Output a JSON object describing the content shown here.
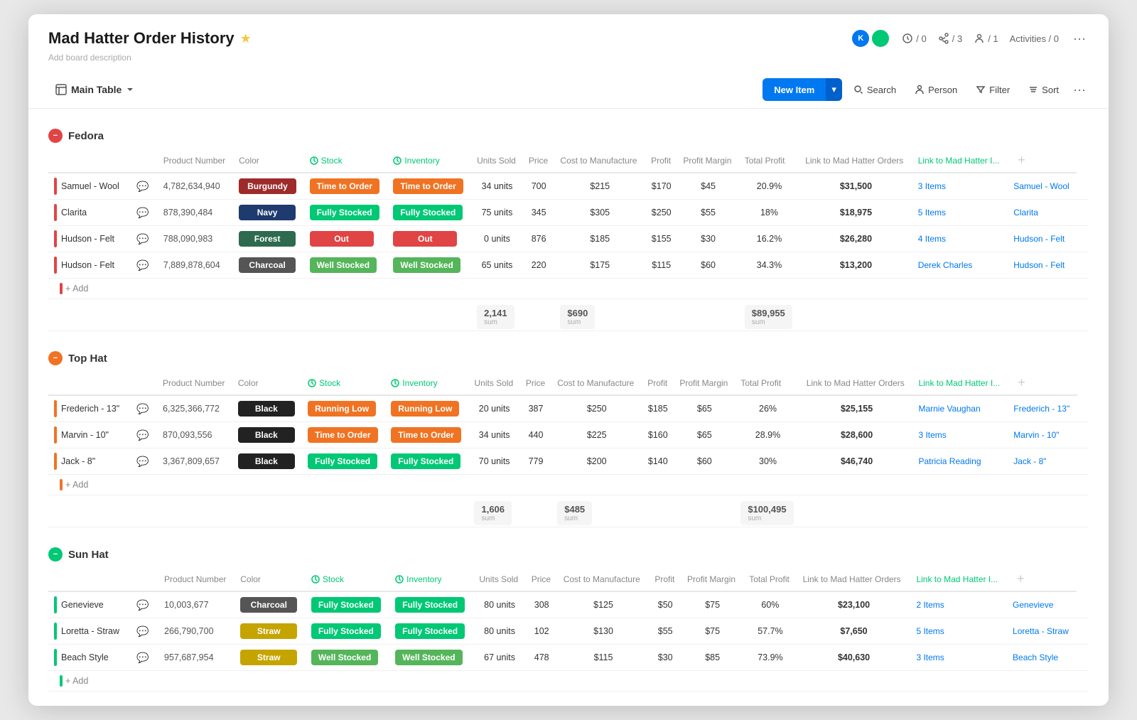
{
  "app": {
    "title": "Mad Hatter Order History",
    "description": "Add board description",
    "star": "★"
  },
  "header": {
    "avatars": [
      {
        "initials": "K",
        "color": "blue"
      },
      {
        "initials": "",
        "color": "green"
      }
    ],
    "stats": [
      {
        "icon": "search-updates",
        "value": "/ 0"
      },
      {
        "icon": "share",
        "value": "/ 3"
      },
      {
        "icon": "people",
        "value": "/ 1"
      },
      {
        "label": "Activities / 0"
      }
    ],
    "more": "···"
  },
  "toolbar": {
    "main_table_label": "Main Table",
    "new_item_label": "New Item",
    "search_label": "Search",
    "person_label": "Person",
    "filter_label": "Filter",
    "sort_label": "Sort",
    "more": "···"
  },
  "groups": [
    {
      "id": "fedora",
      "name": "Fedora",
      "color": "fedora",
      "columns": [
        "Product Number",
        "Color",
        "Stock",
        "Inventory",
        "Units Sold",
        "Price",
        "Cost to Manufacture",
        "Profit",
        "Profit Margin",
        "Total Profit",
        "Link to Mad Hatter Orders",
        "Link to Mad Hatter I..."
      ],
      "rows": [
        {
          "name": "Samuel - Wool",
          "product_number": "4,782,634,940",
          "color": "Burgundy",
          "color_chip": "chip-burgundy",
          "stock": "Time to Order",
          "stock_chip": "chip-tto",
          "inventory": "Time to Order",
          "inventory_chip": "chip-tto",
          "units_sold": "34 units",
          "price": "700",
          "ctm": "$215",
          "profit": "$170",
          "p_margin": "$45",
          "p_margin_pct": "20.9%",
          "total_profit": "$31,500",
          "link_orders": "3 Items",
          "link_other": "Samuel - Wool"
        },
        {
          "name": "Clarita",
          "product_number": "878,390,484",
          "color": "Navy",
          "color_chip": "chip-navy",
          "stock": "Fully Stocked",
          "stock_chip": "chip-fs",
          "inventory": "Fully Stocked",
          "inventory_chip": "chip-fs",
          "units_sold": "75 units",
          "price": "345",
          "ctm": "$305",
          "profit": "$250",
          "p_margin": "$55",
          "p_margin_pct": "18%",
          "total_profit": "$18,975",
          "link_orders": "5 Items",
          "link_other": "Clarita"
        },
        {
          "name": "Hudson - Felt",
          "product_number": "788,090,983",
          "color": "Forest",
          "color_chip": "chip-forest",
          "stock": "Out",
          "stock_chip": "chip-out",
          "inventory": "Out",
          "inventory_chip": "chip-out",
          "units_sold": "0 units",
          "price": "876",
          "ctm": "$185",
          "profit": "$155",
          "p_margin": "$30",
          "p_margin_pct": "16.2%",
          "total_profit": "$26,280",
          "link_orders": "4 Items",
          "link_other": "Hudson - Felt"
        },
        {
          "name": "Hudson - Felt",
          "product_number": "7,889,878,604",
          "color": "Charcoal",
          "color_chip": "chip-charcoal",
          "stock": "Well Stocked",
          "stock_chip": "chip-ws",
          "inventory": "Well Stocked",
          "inventory_chip": "chip-ws",
          "units_sold": "65 units",
          "price": "220",
          "ctm": "$175",
          "profit": "$115",
          "p_margin": "$60",
          "p_margin_pct": "34.3%",
          "total_profit": "$13,200",
          "link_orders": "Derek Charles",
          "link_other": "Hudson - Felt"
        }
      ],
      "sum": {
        "units_sold": "2,141",
        "ctm": "$690",
        "total_profit": "$89,955"
      }
    },
    {
      "id": "tophat",
      "name": "Top Hat",
      "color": "tophat",
      "columns": [
        "Product Number",
        "Color",
        "Stock",
        "Inventory",
        "Units Sold",
        "Price",
        "Cost to Manufacture",
        "Profit",
        "Profit Margin",
        "Total Profit",
        "Link to Mad Hatter Orders",
        "Link to Mad Hatter I..."
      ],
      "rows": [
        {
          "name": "Frederich - 13\"",
          "product_number": "6,325,366,772",
          "color": "Black",
          "color_chip": "chip-black",
          "stock": "Running Low",
          "stock_chip": "chip-rl",
          "inventory": "Running Low",
          "inventory_chip": "chip-rl",
          "units_sold": "20 units",
          "price": "387",
          "ctm": "$250",
          "profit": "$185",
          "p_margin": "$65",
          "p_margin_pct": "26%",
          "total_profit": "$25,155",
          "link_orders": "Marnie Vaughan",
          "link_other": "Frederich - 13\""
        },
        {
          "name": "Marvin - 10\"",
          "product_number": "870,093,556",
          "color": "Black",
          "color_chip": "chip-black",
          "stock": "Time to Order",
          "stock_chip": "chip-tto",
          "inventory": "Time to Order",
          "inventory_chip": "chip-tto",
          "units_sold": "34 units",
          "price": "440",
          "ctm": "$225",
          "profit": "$160",
          "p_margin": "$65",
          "p_margin_pct": "28.9%",
          "total_profit": "$28,600",
          "link_orders": "3 Items",
          "link_other": "Marvin - 10\""
        },
        {
          "name": "Jack - 8\"",
          "product_number": "3,367,809,657",
          "color": "Black",
          "color_chip": "chip-black",
          "stock": "Fully Stocked",
          "stock_chip": "chip-fs",
          "inventory": "Fully Stocked",
          "inventory_chip": "chip-fs",
          "units_sold": "70 units",
          "price": "779",
          "ctm": "$200",
          "profit": "$140",
          "p_margin": "$60",
          "p_margin_pct": "30%",
          "total_profit": "$46,740",
          "link_orders": "Patricia Reading",
          "link_other": "Jack - 8\""
        }
      ],
      "sum": {
        "units_sold": "1,606",
        "ctm": "$485",
        "total_profit": "$100,495"
      }
    },
    {
      "id": "sunhat",
      "name": "Sun Hat",
      "color": "sunhat",
      "columns": [
        "Product Number",
        "Color",
        "Stock",
        "Inventory",
        "Units Sold",
        "Price",
        "Cost to Manufacture",
        "Profit",
        "Profit Margin",
        "Total Profit",
        "Link to Mad Hatter Orders",
        "Link to Mad Hatter I..."
      ],
      "rows": [
        {
          "name": "Genevieve",
          "product_number": "10,003,677",
          "color": "Charcoal",
          "color_chip": "chip-charcoal",
          "stock": "Fully Stocked",
          "stock_chip": "chip-fs",
          "inventory": "Fully Stocked",
          "inventory_chip": "chip-fs",
          "units_sold": "80 units",
          "price": "308",
          "ctm": "$125",
          "profit": "$50",
          "p_margin": "$75",
          "p_margin_pct": "60%",
          "total_profit": "$23,100",
          "link_orders": "2 Items",
          "link_other": "Genevieve"
        },
        {
          "name": "Loretta - Straw",
          "product_number": "266,790,700",
          "color": "Straw",
          "color_chip": "chip-straw",
          "stock": "Fully Stocked",
          "stock_chip": "chip-fs",
          "inventory": "Fully Stocked",
          "inventory_chip": "chip-fs",
          "units_sold": "80 units",
          "price": "102",
          "ctm": "$130",
          "profit": "$55",
          "p_margin": "$75",
          "p_margin_pct": "57.7%",
          "total_profit": "$7,650",
          "link_orders": "5 Items",
          "link_other": "Loretta - Straw"
        },
        {
          "name": "Beach Style",
          "product_number": "957,687,954",
          "color": "Straw",
          "color_chip": "chip-straw",
          "stock": "Well Stocked",
          "stock_chip": "chip-ws",
          "inventory": "Well Stocked",
          "inventory_chip": "chip-ws",
          "units_sold": "67 units",
          "price": "478",
          "ctm": "$115",
          "profit": "$30",
          "p_margin": "$85",
          "p_margin_pct": "73.9%",
          "total_profit": "$40,630",
          "link_orders": "3 Items",
          "link_other": "Beach Style"
        }
      ],
      "sum": {
        "units_sold": "",
        "ctm": "",
        "total_profit": ""
      }
    }
  ]
}
